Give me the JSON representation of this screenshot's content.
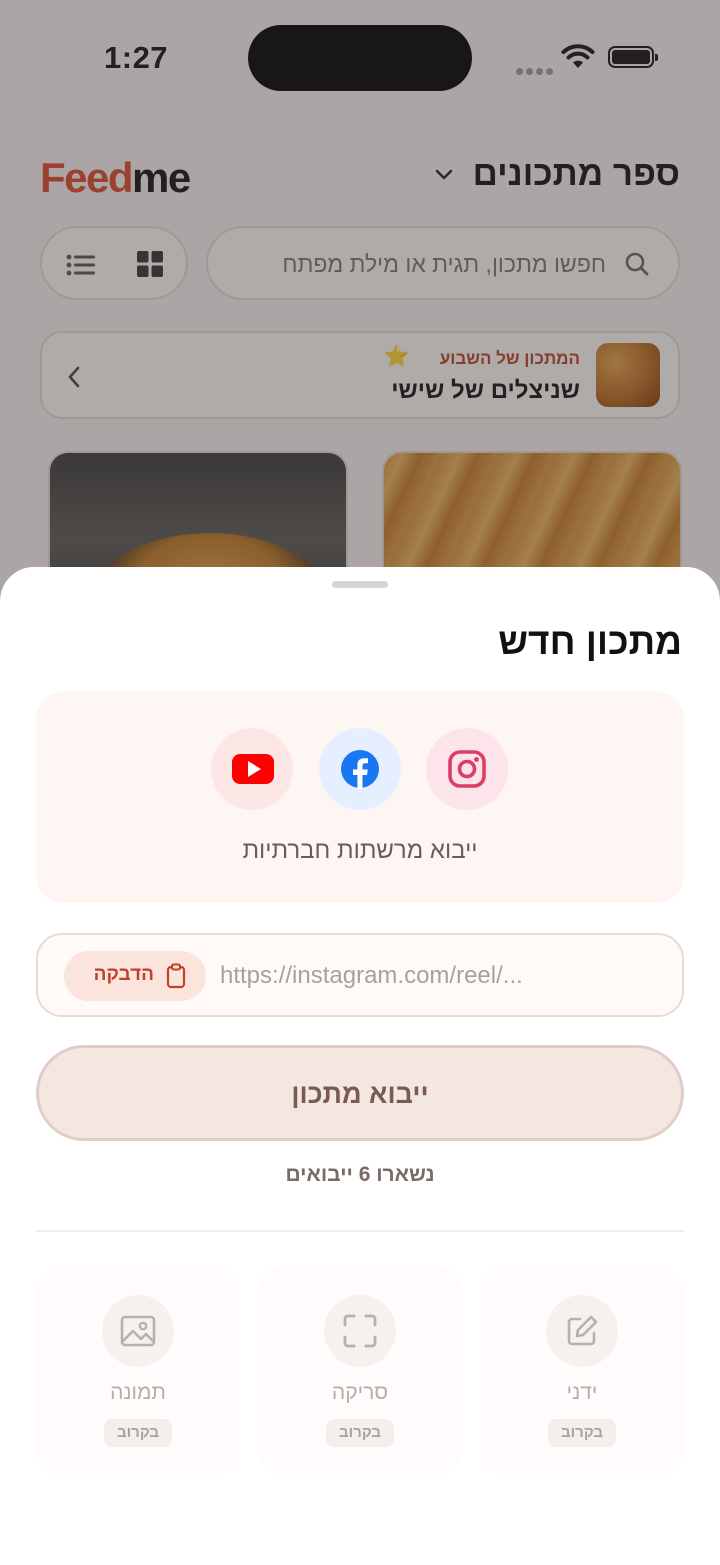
{
  "status_bar": {
    "time": "1:27"
  },
  "header": {
    "logo_part1": "Feed",
    "logo_part2": "me",
    "book_title": "ספר מתכונים"
  },
  "search": {
    "placeholder": "חפשו מתכון, תגית או מילת מפתח"
  },
  "weekly": {
    "label": "המתכון של השבוע",
    "star": "⭐",
    "recipe_name": "שניצלים של שישי"
  },
  "sheet": {
    "title": "מתכון חדש",
    "social_caption": "ייבוא מרשתות חברתיות",
    "social_icons": [
      "youtube-icon",
      "facebook-icon",
      "instagram-icon"
    ],
    "url_placeholder": "https://instagram.com/reel/...",
    "paste_label": "הדבקה",
    "import_label": "ייבוא מתכון",
    "remaining": "נשארו 6 ייבואים",
    "options": [
      {
        "label": "ידני",
        "soon": "בקרוב",
        "icon": "edit-icon"
      },
      {
        "label": "סריקה",
        "soon": "בקרוב",
        "icon": "scan-icon"
      },
      {
        "label": "תמונה",
        "soon": "בקרוב",
        "icon": "image-icon"
      }
    ]
  },
  "colors": {
    "brand": "#d9482b",
    "youtube": "#ff0000",
    "facebook": "#1877f2",
    "instagram": "#e1306c",
    "scrim": "#3c3836"
  }
}
